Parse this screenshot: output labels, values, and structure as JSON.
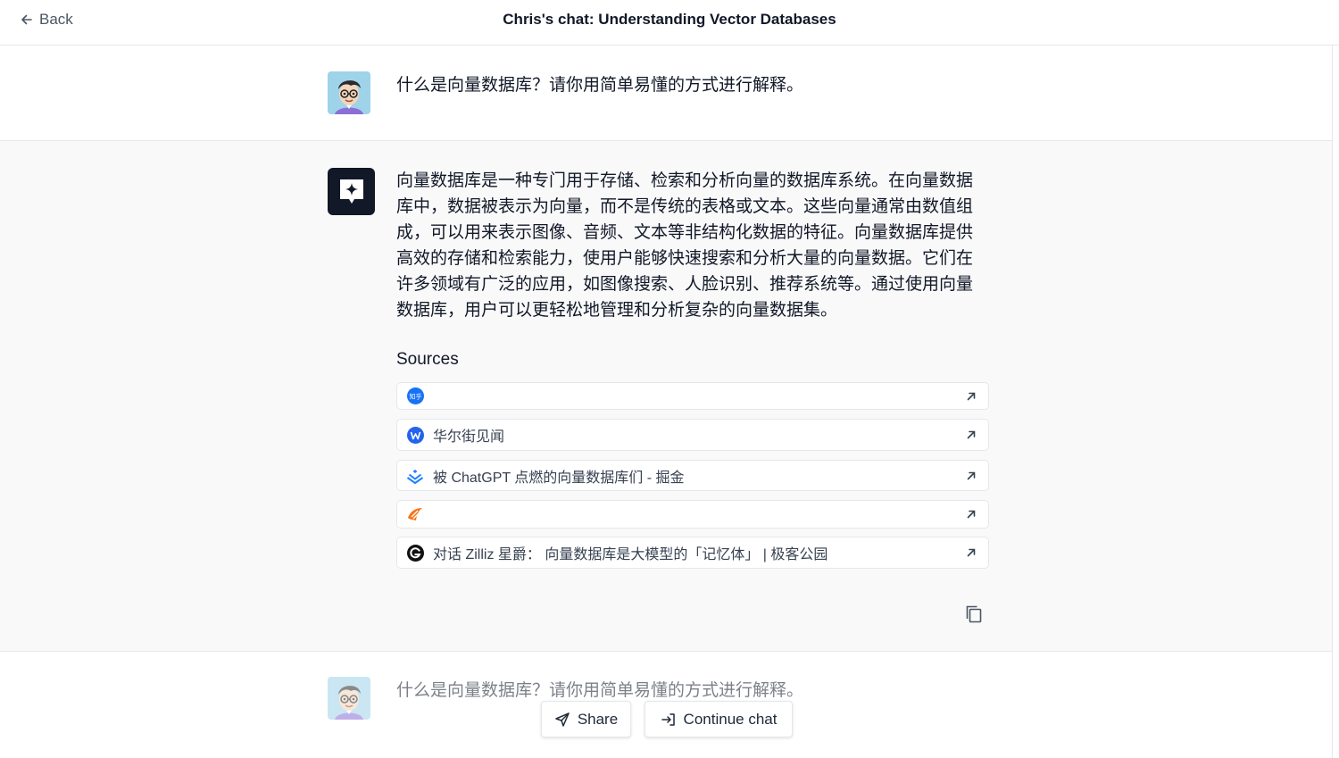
{
  "header": {
    "back_label": "Back",
    "title": "Chris's chat: Understanding Vector Databases"
  },
  "messages": {
    "user_question": "什么是向量数据库？请你用简单易懂的方式进行解释。",
    "ai_answer_lines": [
      "向量数据库是一种专门用于存储、检索和分析向量的数据库系统。在向量数据",
      "库中，数据被表示为向量，而不是传统的表格或文本。这些向量通常由数值组",
      "成，可以用来表示图像、音频、文本等非结构化数据的特征。向量数据库提供",
      "高效的存储和检索能力，使用户能够快速搜索和分析大量的向量数据。它们在",
      "许多领域有广泛的应用，如图像搜索、人脸识别、推荐系统等。通过使用向量",
      "数据库，用户可以更轻松地管理和分析复杂的向量数据集。"
    ],
    "user_question_2": "什么是向量数据库？请你用简单易懂的方式进行解释。"
  },
  "sources": {
    "title": "Sources",
    "items": [
      {
        "label": "",
        "icon": "zhihu-icon",
        "icon_text": "知乎",
        "color": "#1772F6"
      },
      {
        "label": "华尔街见闻",
        "icon": "wallstreetcn-icon",
        "color": "#2563EB"
      },
      {
        "label": "被 ChatGPT 点燃的向量数据库们 - 掘金",
        "icon": "juejin-icon",
        "color": "#1E80FF"
      },
      {
        "label": "",
        "icon": "orange-bird-icon",
        "color": "#F97316"
      },
      {
        "label": "对话 Zilliz 星爵： 向量数据库是大模型的「记忆体」 | 极客公园",
        "icon": "geekpark-icon",
        "color": "#111111"
      }
    ]
  },
  "actions": {
    "share_label": "Share",
    "continue_label": "Continue chat"
  }
}
